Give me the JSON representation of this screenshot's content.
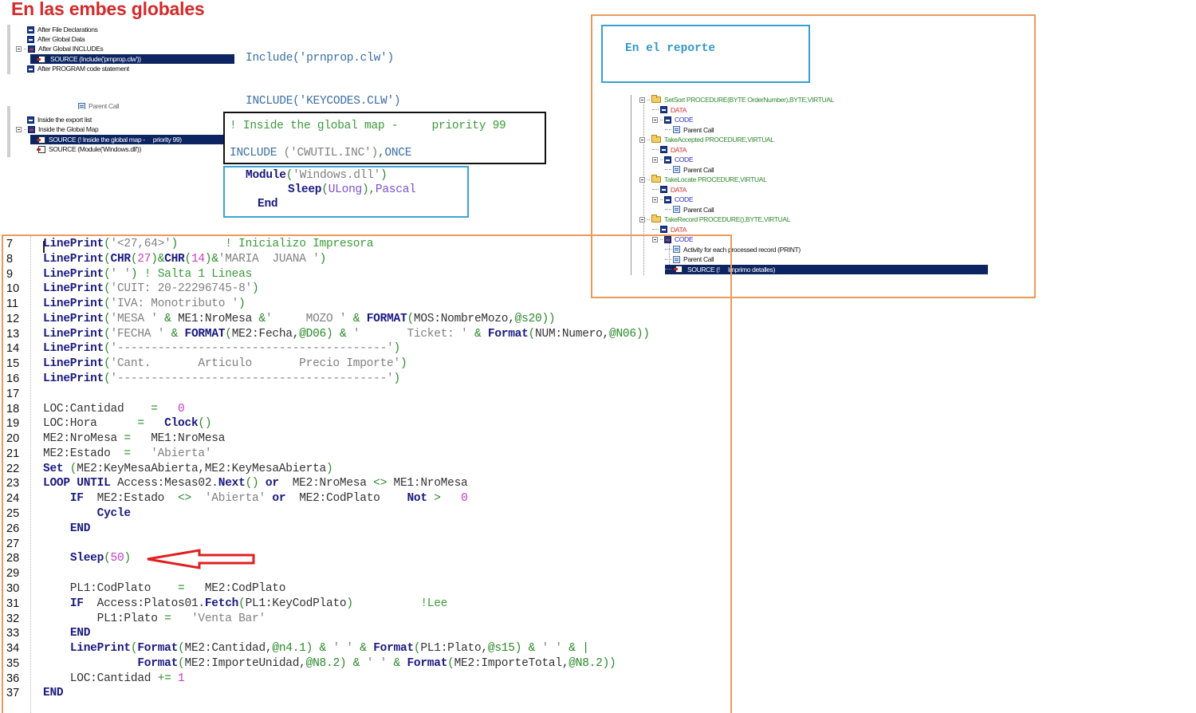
{
  "title": "En las embes globales",
  "global_tree": {
    "items": [
      {
        "label": "After File Declarations",
        "icon": "embed-icon"
      },
      {
        "label": "After Global Data",
        "icon": "embed-icon"
      },
      {
        "label": "After Global INCLUDEs",
        "icon": "embed-icon",
        "expanded": true
      },
      {
        "label": "SOURCE (Include('prnprop.clw'))",
        "icon": "source-icon",
        "selected": true
      },
      {
        "label": "After PROGRAM code statement",
        "icon": "embed-icon"
      }
    ]
  },
  "global_includes_code": [
    "Include('prnprop.clw')",
    "INCLUDE('KEYCODES.CLW')"
  ],
  "map_tree": {
    "items": [
      {
        "label": "Parent Call",
        "icon": "page-icon",
        "partial": true
      },
      {
        "label": "Inside the export list",
        "icon": "embed-icon"
      },
      {
        "label": "Inside the Global Map",
        "icon": "embed-icon",
        "expanded": true
      },
      {
        "label": "SOURCE (! Inside the global map -     priority 99)",
        "icon": "source-icon",
        "selected": true
      },
      {
        "label": "SOURCE (Module('Windows.dll'))",
        "icon": "source-icon"
      }
    ]
  },
  "priority_box": {
    "comment": "! Inside the global map -     priority 99",
    "include_kw": "INCLUDE",
    "include_arg": " ('CWUTIL.INC')",
    "include_comma": ",",
    "include_once": "ONCE"
  },
  "module_box": {
    "module_kw": "Module",
    "module_arg": "'Windows.dll'",
    "sleep_kw": "Sleep",
    "sleep_type": "ULong",
    "sleep_conv": "Pascal",
    "end_kw": "End"
  },
  "report": {
    "title": "En el reporte",
    "tree": [
      {
        "label": "SetSort PROCEDURE(BYTE OrderNumber),BYTE,VIRTUAL",
        "type": "procedure"
      },
      {
        "label": "DATA",
        "type": "data"
      },
      {
        "label": "CODE",
        "type": "code"
      },
      {
        "label": "Parent Call",
        "type": "call"
      },
      {
        "label": "TakeAccepted PROCEDURE,VIRTUAL",
        "type": "procedure"
      },
      {
        "label": "DATA",
        "type": "data"
      },
      {
        "label": "CODE",
        "type": "code"
      },
      {
        "label": "Parent Call",
        "type": "call"
      },
      {
        "label": "TakeLocate PROCEDURE,VIRTUAL",
        "type": "procedure"
      },
      {
        "label": "DATA",
        "type": "data"
      },
      {
        "label": "CODE",
        "type": "code"
      },
      {
        "label": "Parent Call",
        "type": "call"
      },
      {
        "label": "TakeRecord PROCEDURE(),BYTE,VIRTUAL",
        "type": "procedure"
      },
      {
        "label": "DATA",
        "type": "data"
      },
      {
        "label": "CODE",
        "type": "code"
      },
      {
        "label": "Activity for each processed record (PRINT)",
        "type": "call"
      },
      {
        "label": "Parent Call",
        "type": "call"
      },
      {
        "label": "SOURCE (!     Imprimo detalles)",
        "type": "source",
        "selected": true
      }
    ]
  },
  "editor": {
    "lines": [
      {
        "n": "7",
        "tokens": [
          [
            "kw",
            "LinePrint"
          ],
          [
            "op",
            "("
          ],
          [
            "str",
            "'<27,64>'"
          ],
          [
            "op",
            ")"
          ],
          [
            "cmt",
            "       ! Inicializo Impresora"
          ]
        ]
      },
      {
        "n": "8",
        "tokens": [
          [
            "kw",
            "LinePrint"
          ],
          [
            "op",
            "("
          ],
          [
            "kw",
            "CHR"
          ],
          [
            "op",
            "("
          ],
          [
            "num",
            "27"
          ],
          [
            "op",
            ")"
          ],
          [
            "op",
            "&"
          ],
          [
            "kw",
            "CHR"
          ],
          [
            "op",
            "("
          ],
          [
            "num",
            "14"
          ],
          [
            "op",
            ")"
          ],
          [
            "op",
            "&"
          ],
          [
            "str",
            "'MARIA  JUANA '"
          ],
          [
            "op",
            ")"
          ]
        ]
      },
      {
        "n": "9",
        "tokens": [
          [
            "kw",
            "LinePrint"
          ],
          [
            "op",
            "("
          ],
          [
            "str",
            "' '"
          ],
          [
            "op",
            ")"
          ],
          [
            "cmt",
            " ! Salta 1 Lineas"
          ]
        ]
      },
      {
        "n": "10",
        "tokens": [
          [
            "kw",
            "LinePrint"
          ],
          [
            "op",
            "("
          ],
          [
            "str",
            "'CUIT: 20-22296745-8'"
          ],
          [
            "op",
            ")"
          ]
        ]
      },
      {
        "n": "11",
        "tokens": [
          [
            "kw",
            "LinePrint"
          ],
          [
            "op",
            "("
          ],
          [
            "str",
            "'IVA: Monotributo '"
          ],
          [
            "op",
            ")"
          ]
        ]
      },
      {
        "n": "12",
        "tokens": [
          [
            "kw",
            "LinePrint"
          ],
          [
            "op",
            "("
          ],
          [
            "str",
            "'MESA '"
          ],
          [
            "op",
            " & "
          ],
          [
            "id",
            "ME1:NroMesa "
          ],
          [
            "op",
            "&"
          ],
          [
            "str",
            "'     MOZO '"
          ],
          [
            "op",
            " & "
          ],
          [
            "kw",
            "FORMAT"
          ],
          [
            "op",
            "("
          ],
          [
            "id",
            "MOS:NombreMozo,"
          ],
          [
            "op",
            "@s20"
          ],
          [
            "op",
            "))"
          ]
        ]
      },
      {
        "n": "13",
        "tokens": [
          [
            "kw",
            "LinePrint"
          ],
          [
            "op",
            "("
          ],
          [
            "str",
            "'FECHA '"
          ],
          [
            "op",
            " & "
          ],
          [
            "kw",
            "FORMAT"
          ],
          [
            "op",
            "("
          ],
          [
            "id",
            "ME2:Fecha,"
          ],
          [
            "op",
            "@D06"
          ],
          [
            "op",
            ")"
          ],
          [
            "op",
            " & "
          ],
          [
            "str",
            "'       Ticket: '"
          ],
          [
            "op",
            " & "
          ],
          [
            "kw",
            "Format"
          ],
          [
            "op",
            "("
          ],
          [
            "id",
            "NUM:Numero,"
          ],
          [
            "op",
            "@N06"
          ],
          [
            "op",
            "))"
          ]
        ]
      },
      {
        "n": "14",
        "tokens": [
          [
            "kw",
            "LinePrint"
          ],
          [
            "op",
            "("
          ],
          [
            "str",
            "'----------------------------------------'"
          ],
          [
            "op",
            ")"
          ]
        ]
      },
      {
        "n": "15",
        "tokens": [
          [
            "kw",
            "LinePrint"
          ],
          [
            "op",
            "("
          ],
          [
            "str",
            "'Cant.       Articulo       Precio Importe'"
          ],
          [
            "op",
            ")"
          ]
        ]
      },
      {
        "n": "16",
        "tokens": [
          [
            "kw",
            "LinePrint"
          ],
          [
            "op",
            "("
          ],
          [
            "str",
            "'----------------------------------------'"
          ],
          [
            "op",
            ")"
          ]
        ]
      },
      {
        "n": "17",
        "tokens": []
      },
      {
        "n": "18",
        "tokens": [
          [
            "id",
            "LOC:Cantidad    "
          ],
          [
            "op",
            "="
          ],
          [
            "id",
            "   "
          ],
          [
            "num",
            "0"
          ]
        ]
      },
      {
        "n": "19",
        "tokens": [
          [
            "id",
            "LOC:Hora      "
          ],
          [
            "op",
            "="
          ],
          [
            "id",
            "   "
          ],
          [
            "kw",
            "Clock"
          ],
          [
            "op",
            "()"
          ]
        ]
      },
      {
        "n": "20",
        "tokens": [
          [
            "id",
            "ME2:NroMesa "
          ],
          [
            "op",
            "="
          ],
          [
            "id",
            "   ME1:NroMesa"
          ]
        ]
      },
      {
        "n": "21",
        "tokens": [
          [
            "id",
            "ME2:Estado  "
          ],
          [
            "op",
            "="
          ],
          [
            "id",
            "   "
          ],
          [
            "str",
            "'Abierta'"
          ]
        ]
      },
      {
        "n": "22",
        "tokens": [
          [
            "kw",
            "Set"
          ],
          [
            "op",
            " ("
          ],
          [
            "id",
            "ME2:KeyMesaAbierta,ME2:KeyMesaAbierta"
          ],
          [
            "op",
            ")"
          ]
        ]
      },
      {
        "n": "23",
        "tokens": [
          [
            "kw",
            "LOOP UNTIL"
          ],
          [
            "id",
            " Access:Mesas02."
          ],
          [
            "kw",
            "Next"
          ],
          [
            "op",
            "()"
          ],
          [
            "id",
            " "
          ],
          [
            "kw",
            "or"
          ],
          [
            "id",
            "  ME2:NroMesa "
          ],
          [
            "op",
            "<>"
          ],
          [
            "id",
            " ME1:NroMesa"
          ]
        ]
      },
      {
        "n": "24",
        "tokens": [
          [
            "id",
            "    "
          ],
          [
            "kw",
            "IF"
          ],
          [
            "id",
            "  ME2:Estado  "
          ],
          [
            "op",
            "<>"
          ],
          [
            "id",
            "  "
          ],
          [
            "str",
            "'Abierta'"
          ],
          [
            "id",
            " "
          ],
          [
            "kw",
            "or"
          ],
          [
            "id",
            "  ME2:CodPlato    "
          ],
          [
            "kw",
            "Not"
          ],
          [
            "op",
            " >"
          ],
          [
            "id",
            "   "
          ],
          [
            "num",
            "0"
          ]
        ]
      },
      {
        "n": "25",
        "tokens": [
          [
            "id",
            "        "
          ],
          [
            "kw",
            "Cycle"
          ]
        ]
      },
      {
        "n": "26",
        "tokens": [
          [
            "id",
            "    "
          ],
          [
            "kw",
            "END"
          ]
        ]
      },
      {
        "n": "27",
        "tokens": []
      },
      {
        "n": "28",
        "tokens": [
          [
            "id",
            "    "
          ],
          [
            "kw",
            "Sleep"
          ],
          [
            "op",
            "("
          ],
          [
            "num",
            "50"
          ],
          [
            "op",
            ")"
          ]
        ]
      },
      {
        "n": "29",
        "tokens": []
      },
      {
        "n": "30",
        "tokens": [
          [
            "id",
            "    PL1:CodPlato    "
          ],
          [
            "op",
            "="
          ],
          [
            "id",
            "   ME2:CodPlato"
          ]
        ]
      },
      {
        "n": "31",
        "tokens": [
          [
            "id",
            "    "
          ],
          [
            "kw",
            "IF"
          ],
          [
            "id",
            "  Access:Platos01."
          ],
          [
            "kw",
            "Fetch"
          ],
          [
            "op",
            "("
          ],
          [
            "id",
            "PL1:KeyCodPlato"
          ],
          [
            "op",
            ")"
          ],
          [
            "cmt",
            "          !Lee"
          ]
        ]
      },
      {
        "n": "32",
        "tokens": [
          [
            "id",
            "        PL1:Plato "
          ],
          [
            "op",
            "="
          ],
          [
            "id",
            "   "
          ],
          [
            "str",
            "'Venta Bar'"
          ]
        ]
      },
      {
        "n": "33",
        "tokens": [
          [
            "id",
            "    "
          ],
          [
            "kw",
            "END"
          ]
        ]
      },
      {
        "n": "34",
        "tokens": [
          [
            "id",
            "    "
          ],
          [
            "kw",
            "LinePrint"
          ],
          [
            "op",
            "("
          ],
          [
            "kw",
            "Format"
          ],
          [
            "op",
            "("
          ],
          [
            "id",
            "ME2:Cantidad,"
          ],
          [
            "op",
            "@n4.1"
          ],
          [
            "op",
            ")"
          ],
          [
            "op",
            " & "
          ],
          [
            "str",
            "' '"
          ],
          [
            "op",
            " & "
          ],
          [
            "kw",
            "Format"
          ],
          [
            "op",
            "("
          ],
          [
            "id",
            "PL1:Plato,"
          ],
          [
            "op",
            "@s15"
          ],
          [
            "op",
            ")"
          ],
          [
            "op",
            " & "
          ],
          [
            "str",
            "' '"
          ],
          [
            "op",
            " & |"
          ]
        ]
      },
      {
        "n": "35",
        "tokens": [
          [
            "id",
            "              "
          ],
          [
            "kw",
            "Format"
          ],
          [
            "op",
            "("
          ],
          [
            "id",
            "ME2:ImporteUnidad,"
          ],
          [
            "op",
            "@N8.2"
          ],
          [
            "op",
            ")"
          ],
          [
            "op",
            " & "
          ],
          [
            "str",
            "' '"
          ],
          [
            "op",
            " & "
          ],
          [
            "kw",
            "Format"
          ],
          [
            "op",
            "("
          ],
          [
            "id",
            "ME2:ImporteTotal,"
          ],
          [
            "op",
            "@N8.2"
          ],
          [
            "op",
            "))"
          ]
        ]
      },
      {
        "n": "36",
        "tokens": [
          [
            "id",
            "    LOC:Cantidad "
          ],
          [
            "op",
            "+="
          ],
          [
            "id",
            " "
          ],
          [
            "num",
            "1"
          ]
        ]
      },
      {
        "n": "37",
        "tokens": [
          [
            "kw",
            "END"
          ]
        ]
      }
    ]
  },
  "colors": {
    "title_red": "#d42a2a",
    "orange_frame": "#eb9a5a",
    "blue_frame": "#36a0d2",
    "selection_navy": "#0c2461",
    "arrow_red": "#e02020"
  }
}
